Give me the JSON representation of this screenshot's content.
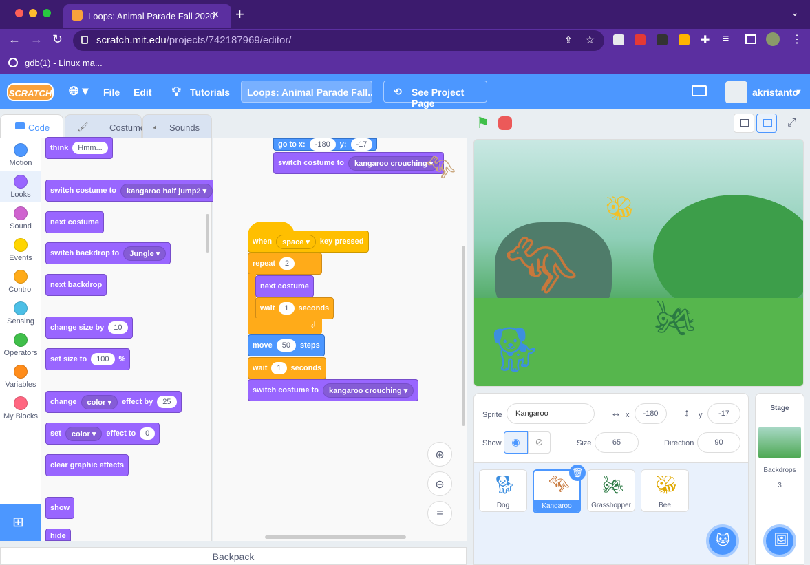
{
  "browser": {
    "tab_title": "Loops: Animal Parade Fall 2020",
    "url_host": "scratch.mit.edu",
    "url_path": "/projects/742187969/editor/",
    "bookmark": "gdb(1) - Linux ma..."
  },
  "menubar": {
    "logo": "SCRATCH",
    "file": "File",
    "edit": "Edit",
    "tutorials": "Tutorials",
    "project_title": "Loops: Animal Parade Fall...",
    "see_project": "See Project Page",
    "username": "akristanto"
  },
  "editor_tabs": [
    "Code",
    "Costumes",
    "Sounds"
  ],
  "categories": [
    {
      "label": "Motion",
      "color": "#4c97ff"
    },
    {
      "label": "Looks",
      "color": "#9966ff"
    },
    {
      "label": "Sound",
      "color": "#cf63cf"
    },
    {
      "label": "Events",
      "color": "#ffd500"
    },
    {
      "label": "Control",
      "color": "#ffab19"
    },
    {
      "label": "Sensing",
      "color": "#4cbfe6"
    },
    {
      "label": "Operators",
      "color": "#40bf4a"
    },
    {
      "label": "Variables",
      "color": "#ff8c1a"
    },
    {
      "label": "My Blocks",
      "color": "#ff6680"
    }
  ],
  "palette": {
    "think": "think",
    "think_val": "Hmm...",
    "switch_costume": "switch costume to",
    "switch_costume_val": "kangaroo half jump2",
    "next_costume": "next costume",
    "switch_backdrop": "switch backdrop to",
    "switch_backdrop_val": "Jungle",
    "next_backdrop": "next backdrop",
    "change_size": "change size by",
    "change_size_val": "10",
    "set_size": "set size to",
    "set_size_val": "100",
    "set_size_unit": "%",
    "change_effect": "change",
    "change_effect_dd": "color",
    "change_effect_by": "effect by",
    "change_effect_val": "25",
    "set_effect": "set",
    "set_effect_dd": "color",
    "set_effect_to": "effect to",
    "set_effect_val": "0",
    "clear_effects": "clear graphic effects",
    "show": "show",
    "hide": "hide"
  },
  "script": {
    "goto": "go to x:",
    "goto_x": "-180",
    "goto_y_label": "y:",
    "goto_y": "-17",
    "top_switch": "switch costume to",
    "top_switch_val": "kangaroo crouching",
    "when": "when",
    "key": "space",
    "key_pressed": "key pressed",
    "repeat": "repeat",
    "repeat_val": "2",
    "next_costume": "next costume",
    "wait": "wait",
    "wait_val": "1",
    "seconds": "seconds",
    "move": "move",
    "move_val": "50",
    "steps": "steps",
    "wait2": "wait",
    "wait2_val": "1",
    "seconds2": "seconds",
    "switch2": "switch costume to",
    "switch2_val": "kangaroo crouching"
  },
  "backpack": "Backpack",
  "sprite_info": {
    "sprite_label": "Sprite",
    "sprite_name": "Kangaroo",
    "x_label": "x",
    "x": "-180",
    "y_label": "y",
    "y": "-17",
    "show_label": "Show",
    "size_label": "Size",
    "size": "65",
    "direction_label": "Direction",
    "direction": "90"
  },
  "sprites": [
    "Dog",
    "Kangaroo",
    "Grasshopper",
    "Bee"
  ],
  "stage_panel": {
    "title": "Stage",
    "backdrops_label": "Backdrops",
    "backdrops_count": "3"
  }
}
